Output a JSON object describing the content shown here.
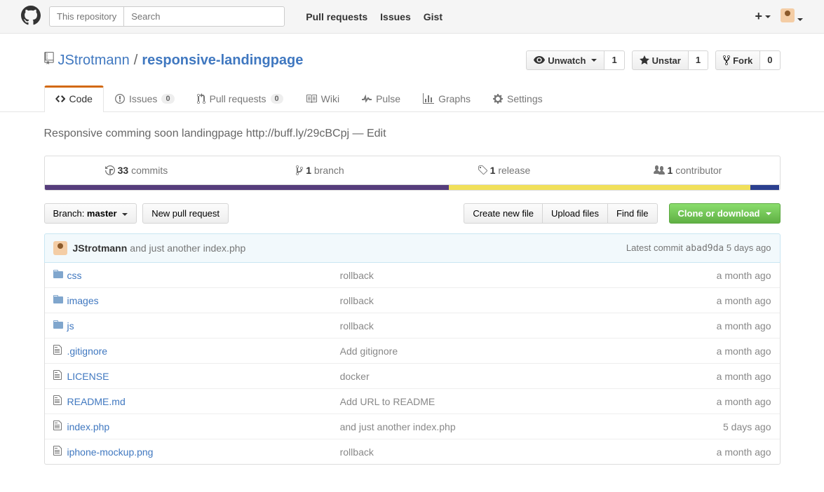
{
  "topbar": {
    "scope_label": "This repository",
    "search_placeholder": "Search",
    "nav": {
      "pulls": "Pull requests",
      "issues": "Issues",
      "gist": "Gist"
    }
  },
  "repo": {
    "owner": "JStrotmann",
    "name": "responsive-landingpage",
    "description": "Responsive comming soon landingpage",
    "url": "http://buff.ly/29cBCpj",
    "edit_label": "Edit"
  },
  "actions": {
    "watch": {
      "label": "Unwatch",
      "count": "1"
    },
    "star": {
      "label": "Unstar",
      "count": "1"
    },
    "fork": {
      "label": "Fork",
      "count": "0"
    }
  },
  "tabs": {
    "code": "Code",
    "issues": {
      "label": "Issues",
      "count": "0"
    },
    "pulls": {
      "label": "Pull requests",
      "count": "0"
    },
    "wiki": "Wiki",
    "pulse": "Pulse",
    "graphs": "Graphs",
    "settings": "Settings"
  },
  "summary": {
    "commits": {
      "count": "33",
      "label": "commits"
    },
    "branches": {
      "count": "1",
      "label": "branch"
    },
    "releases": {
      "count": "1",
      "label": "release"
    },
    "contributors": {
      "count": "1",
      "label": "contributor"
    }
  },
  "languages": [
    {
      "color": "#563d7c",
      "pct": 55
    },
    {
      "color": "#f1e05a",
      "pct": 41
    },
    {
      "color": "#2b3f8f",
      "pct": 4
    }
  ],
  "branch_selector": {
    "prefix": "Branch: ",
    "name": "master"
  },
  "buttons": {
    "new_pr": "New pull request",
    "create_file": "Create new file",
    "upload": "Upload files",
    "find": "Find file",
    "clone": "Clone or download"
  },
  "latest_commit": {
    "author": "JStrotmann",
    "message": "and just another index.php",
    "prefix": "Latest commit",
    "sha": "abad9da",
    "age": "5 days ago"
  },
  "files": [
    {
      "type": "dir",
      "name": "css",
      "msg": "rollback",
      "age": "a month ago"
    },
    {
      "type": "dir",
      "name": "images",
      "msg": "rollback",
      "age": "a month ago"
    },
    {
      "type": "dir",
      "name": "js",
      "msg": "rollback",
      "age": "a month ago"
    },
    {
      "type": "file",
      "name": ".gitignore",
      "msg": "Add gitignore",
      "age": "a month ago"
    },
    {
      "type": "file",
      "name": "LICENSE",
      "msg": "docker",
      "age": "a month ago"
    },
    {
      "type": "file",
      "name": "README.md",
      "msg": "Add URL to README",
      "age": "a month ago"
    },
    {
      "type": "file",
      "name": "index.php",
      "msg": "and just another index.php",
      "age": "5 days ago"
    },
    {
      "type": "file",
      "name": "iphone-mockup.png",
      "msg": "rollback",
      "age": "a month ago"
    }
  ]
}
